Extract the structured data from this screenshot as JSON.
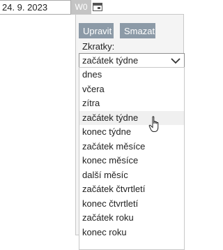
{
  "date_field": {
    "value": "24. 9. 2023",
    "week_label": "W0"
  },
  "icons": {
    "calendar": "calendar-icon",
    "dropdown": "chevron-down-icon",
    "cursor": "hand-pointer-icon"
  },
  "panel": {
    "edit_label": "Upravit",
    "delete_label": "Smazat",
    "shortcuts_label": "Zkratky:",
    "selected_value": "začátek týdne",
    "options": [
      "dnes",
      "včera",
      "zítra",
      "začátek týdne",
      "konec týdne",
      "začátek měsíce",
      "konec měsíce",
      "další měsíc",
      "začátek čtvrtletí",
      "konec čtvrtletí",
      "začátek roku",
      "konec roku"
    ],
    "hovered_index": 3
  },
  "colors": {
    "button_bg": "#8c9aa7",
    "week_badge_bg": "#c4c4c4",
    "hover_bg": "#f0f0f0"
  }
}
